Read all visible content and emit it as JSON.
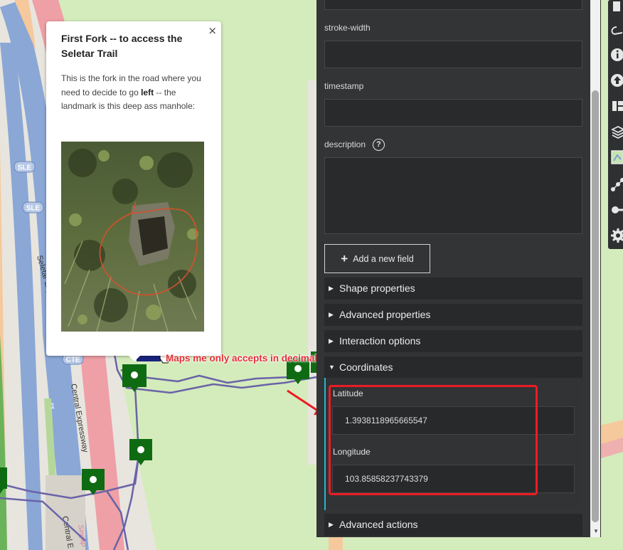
{
  "popup": {
    "title": "First Fork -- to access the Seletar Trail",
    "body_before": "This is the fork in the road where you need to decide to go ",
    "body_bold": "left",
    "body_after": " -- the landmark is this deep ass manhole:",
    "close_symbol": "×"
  },
  "map_labels": {
    "sle_badge": "SLE",
    "cte_badge": "CTE",
    "seletar_expressway": "Seletar Expressway",
    "central_expressway": "Central Expressway",
    "central_expressway_2": "Central E",
    "lane_number": "1",
    "singapore_label": "Singap"
  },
  "annotation": {
    "text": "Maps me only accepts in decimals",
    "color": "#e53035"
  },
  "panel": {
    "fields": [
      {
        "label": "stroke-width",
        "value": ""
      },
      {
        "label": "timestamp",
        "value": ""
      }
    ],
    "description_label": "description",
    "help_icon": "question-mark-icon",
    "add_field_label": "Add a new field",
    "sections": [
      {
        "label": "Shape properties",
        "expanded": false
      },
      {
        "label": "Advanced properties",
        "expanded": false
      },
      {
        "label": "Interaction options",
        "expanded": false
      },
      {
        "label": "Coordinates",
        "expanded": true
      },
      {
        "label": "Advanced actions",
        "expanded": false
      }
    ],
    "coordinates": {
      "latitude_label": "Latitude",
      "latitude_value": "1.3938118965665547",
      "longitude_label": "Longitude",
      "longitude_value": "103.85858237743379"
    }
  },
  "toolbar": {
    "icons": [
      "draw-icon",
      "line-icon",
      "info-icon",
      "upload-icon",
      "layout-icon",
      "layers-icon",
      "map-tiles-icon",
      "route-icon",
      "key-icon",
      "settings-icon"
    ]
  },
  "colors": {
    "panel_bg": "#323436",
    "accent_cyan": "#27b6cf",
    "highlight_red": "#ec1c24",
    "marker_green": "#0f6b12",
    "track_purple": "#6a63a8"
  }
}
